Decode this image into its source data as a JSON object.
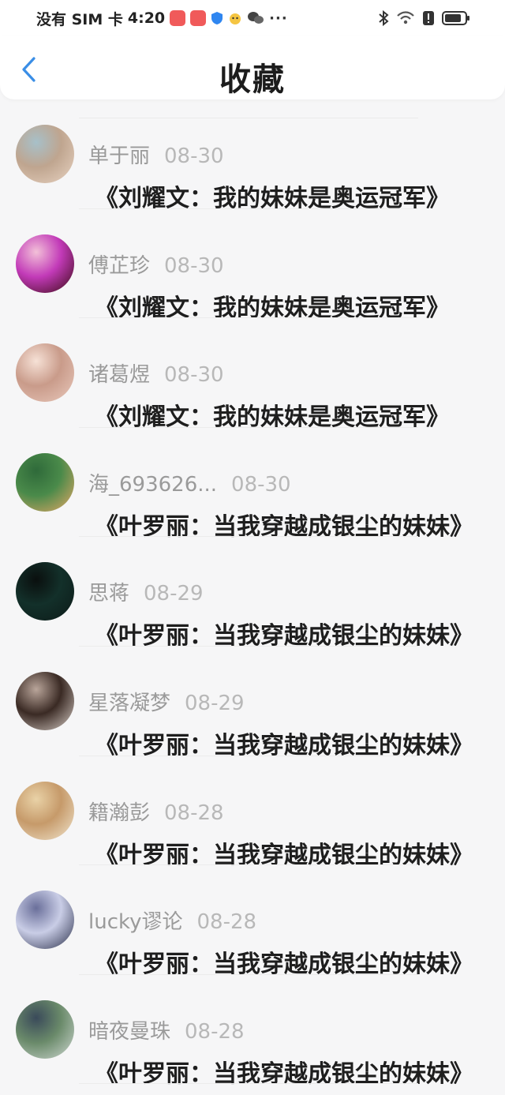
{
  "status_bar": {
    "carrier": "没有 SIM 卡",
    "time": "4:20",
    "more": "···"
  },
  "header": {
    "back_icon": "chevron-left-icon",
    "title": "收藏"
  },
  "colors": {
    "accent": "#3a8ee6",
    "background": "#f6f6f7"
  },
  "favorites": [
    {
      "name": "单于丽",
      "date": "08-30",
      "book": "《刘耀文：我的妹妹是奥运冠军》",
      "avatar_colors": [
        "#e8d3c2",
        "#bfa58f",
        "#a7c0c9"
      ]
    },
    {
      "name": "傅芷珍",
      "date": "08-30",
      "book": "《刘耀文：我的妹妹是奥运冠军》",
      "avatar_colors": [
        "#3a0a12",
        "#c23ab8",
        "#f2c0d8"
      ]
    },
    {
      "name": "诸葛煜",
      "date": "08-30",
      "book": "《刘耀文：我的妹妹是奥运冠军》",
      "avatar_colors": [
        "#e9c9bc",
        "#c99b8a",
        "#f6e1d6"
      ]
    },
    {
      "name": "海_693626...",
      "date": "08-30",
      "book": "《叶罗丽：当我穿越成银尘的妹妹》",
      "avatar_colors": [
        "#e8a866",
        "#4a8a4a",
        "#2f6a3a"
      ]
    },
    {
      "name": "思蒋",
      "date": "08-29",
      "book": "《叶罗丽：当我穿越成银尘的妹妹》",
      "avatar_colors": [
        "#0c1a18",
        "#13302a",
        "#0a0f0e"
      ]
    },
    {
      "name": "星落凝梦",
      "date": "08-29",
      "book": "《叶罗丽：当我穿越成银尘的妹妹》",
      "avatar_colors": [
        "#d9cfc8",
        "#3a2a24",
        "#b9a59a"
      ]
    },
    {
      "name": "籍瀚彭",
      "date": "08-28",
      "book": "《叶罗丽：当我穿越成银尘的妹妹》",
      "avatar_colors": [
        "#f1e6cf",
        "#c69a6a",
        "#e9d2a7"
      ]
    },
    {
      "name": "lucky谬论",
      "date": "08-28",
      "book": "《叶罗丽：当我穿越成银尘的妹妹》",
      "avatar_colors": [
        "#2a2f4a",
        "#c9cde6",
        "#6a6f9a"
      ]
    },
    {
      "name": "暗夜曼珠",
      "date": "08-28",
      "book": "《叶罗丽：当我穿越成银尘的妹妹》",
      "avatar_colors": [
        "#cfd8d2",
        "#6a8a6a",
        "#3a4a5a"
      ]
    }
  ]
}
